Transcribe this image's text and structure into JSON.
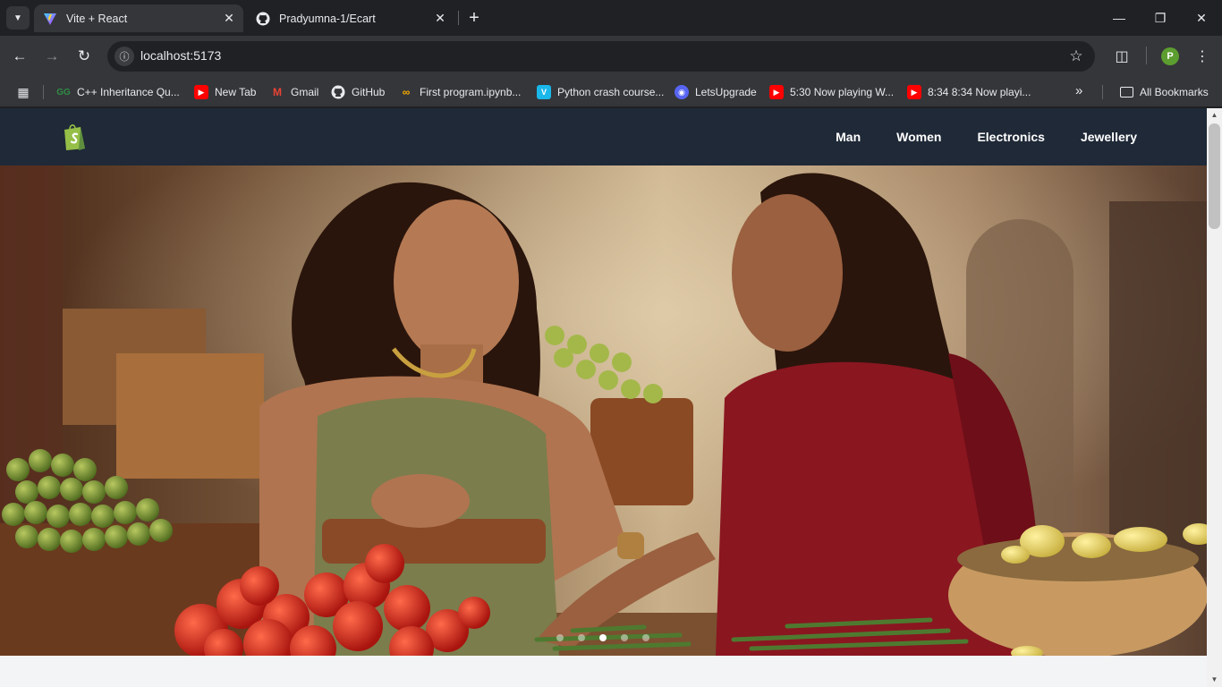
{
  "browser": {
    "tabs": [
      {
        "title": "Vite + React",
        "active": true,
        "icon": "vite-icon"
      },
      {
        "title": "Pradyumna-1/Ecart",
        "active": false,
        "icon": "github-icon"
      }
    ],
    "url": "localhost:5173",
    "profile_initial": "P"
  },
  "bookmarks": [
    {
      "label": "C++ Inheritance Qu...",
      "icon": "gfg-icon",
      "color": "#2f8d46"
    },
    {
      "label": "New Tab",
      "icon": "youtube-icon",
      "color": "#ff0000"
    },
    {
      "label": "Gmail",
      "icon": "gmail-icon",
      "color": "#ea4335"
    },
    {
      "label": "GitHub",
      "icon": "github-icon",
      "color": "#ffffff"
    },
    {
      "label": "First program.ipynb...",
      "icon": "colab-icon",
      "color": "#f9ab00"
    },
    {
      "label": "Python crash course...",
      "icon": "vimeo-icon",
      "color": "#1ab7ea"
    },
    {
      "label": "LetsUpgrade",
      "icon": "discord-icon",
      "color": "#5865f2"
    },
    {
      "label": "5:30 Now playing W...",
      "icon": "youtube-icon",
      "color": "#ff0000"
    },
    {
      "label": "8:34 8:34 Now playi...",
      "icon": "youtube-icon",
      "color": "#ff0000"
    }
  ],
  "all_bookmarks_label": "All Bookmarks",
  "site": {
    "nav": [
      "Man",
      "Women",
      "Electronics",
      "Jewellery"
    ],
    "brand_color": "#95bf47",
    "header_bg": "#1f2937"
  },
  "carousel": {
    "slide_count": 5,
    "active_index": 2
  }
}
